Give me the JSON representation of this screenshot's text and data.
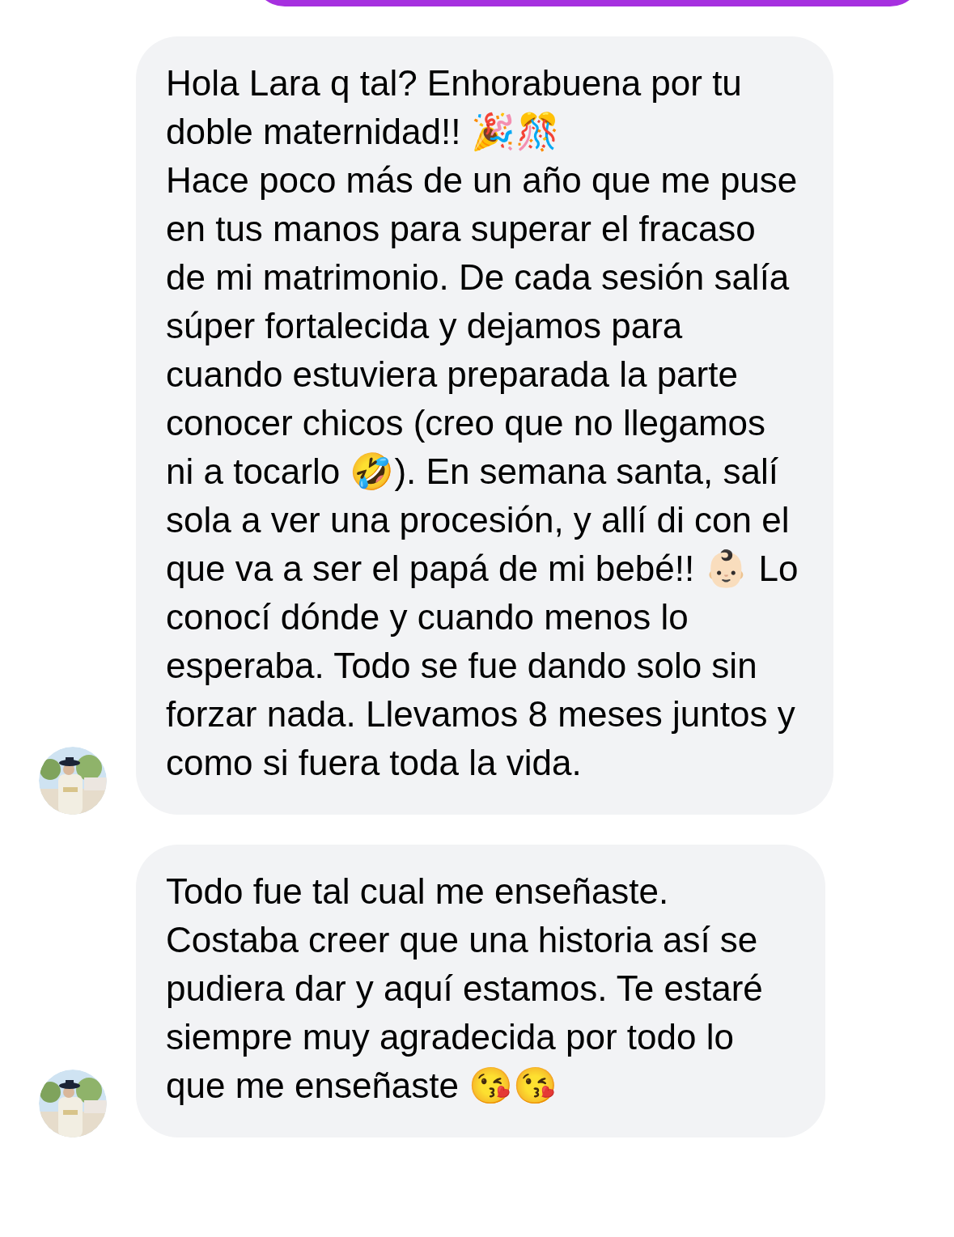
{
  "messages": [
    {
      "text": "Hola Lara q tal? Enhorabuena por tu doble maternidad!! 🎉🎊\nHace poco más de un año que me puse en tus manos para superar el fracaso de mi matrimonio. De cada sesión salía súper fortalecida y dejamos para cuando estuviera preparada la parte conocer chicos (creo que no llegamos ni a tocarlo 🤣). En semana santa, salí sola a ver una procesión, y allí di con el que va a ser el papá de mi bebé!! 👶🏻 Lo conocí dónde y cuando menos lo esperaba. Todo se fue dando solo sin forzar nada. Llevamos 8 meses juntos y como si fuera toda la vida."
    },
    {
      "text": "Todo fue tal cual me enseñaste. Costaba creer que una historia así se pudiera dar y aquí estamos. Te estaré siempre muy agradecida por todo lo que me enseñaste 😘😘"
    }
  ]
}
